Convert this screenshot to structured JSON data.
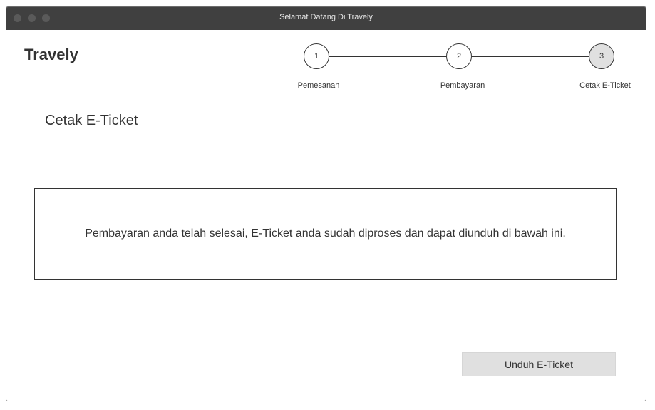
{
  "window": {
    "title": "Selamat Datang Di Travely"
  },
  "header": {
    "brand": "Travely"
  },
  "stepper": {
    "steps": [
      {
        "number": "1",
        "label": "Pemesanan",
        "active": false
      },
      {
        "number": "2",
        "label": "Pembayaran",
        "active": false
      },
      {
        "number": "3",
        "label": "Cetak E-Ticket",
        "active": true
      }
    ]
  },
  "main": {
    "section_title": "Cetak E-Ticket",
    "message": "Pembayaran anda telah selesai, E-Ticket anda sudah diproses dan dapat diunduh di bawah ini.",
    "download_label": "Unduh E-Ticket"
  },
  "colors": {
    "titlebar": "#404040",
    "active_step": "#e0e0e0",
    "button_bg": "#e0e0e0",
    "text": "#333333"
  }
}
